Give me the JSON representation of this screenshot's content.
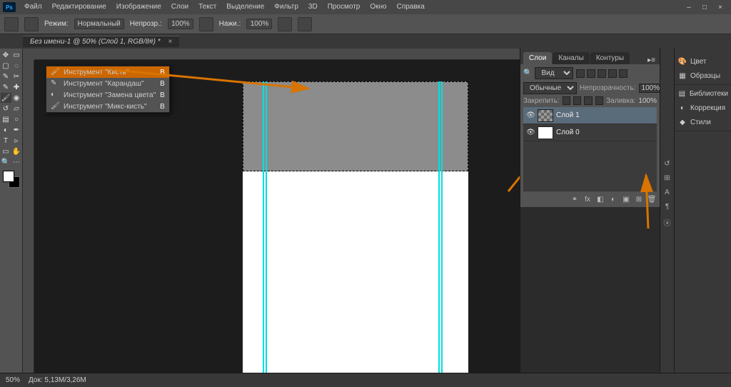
{
  "app": {
    "logo": "Ps"
  },
  "menu": {
    "items": [
      "Файл",
      "Редактирование",
      "Изображение",
      "Слои",
      "Текст",
      "Выделение",
      "Фильтр",
      "3D",
      "Просмотр",
      "Окно",
      "Справка"
    ]
  },
  "options": {
    "mode_label": "Режим:",
    "mode_value": "Нормальный",
    "opacity_label": "Непрозр.:",
    "opacity_value": "100%",
    "flow_label": "Нажи.:",
    "flow_value": "100%"
  },
  "doctab": {
    "title": "Без имени-1 @ 50% (Слой 1, RGB/8#) *",
    "close": "×"
  },
  "flyout": {
    "items": [
      {
        "label": "Инструмент \"Кисть\"",
        "key": "B",
        "active": true
      },
      {
        "label": "Инструмент \"Карандаш\"",
        "key": "B",
        "active": false
      },
      {
        "label": "Инструмент \"Замена цвета\"",
        "key": "B",
        "active": false
      },
      {
        "label": "Инструмент \"Микс-кисть\"",
        "key": "B",
        "active": false
      }
    ]
  },
  "panels": {
    "tabs": [
      "Слои",
      "Каналы",
      "Контуры"
    ],
    "search_label": "Вид",
    "blend_mode": "Обычные",
    "opacity_label": "Непрозрачность:",
    "opacity_value": "100%",
    "lock_label": "Закрепить:",
    "fill_label": "Заливка:",
    "fill_value": "100%",
    "layers": [
      {
        "name": "Слой 1",
        "active": true,
        "checker": true
      },
      {
        "name": "Слой 0",
        "active": false,
        "checker": false
      }
    ]
  },
  "dock": {
    "groups": [
      [
        "Цвет",
        "Образцы"
      ],
      [
        "Библиотеки",
        "Коррекция",
        "Стили"
      ]
    ]
  },
  "status": {
    "zoom": "50%",
    "docinfo": "Док: 5,13М/3,26М"
  }
}
